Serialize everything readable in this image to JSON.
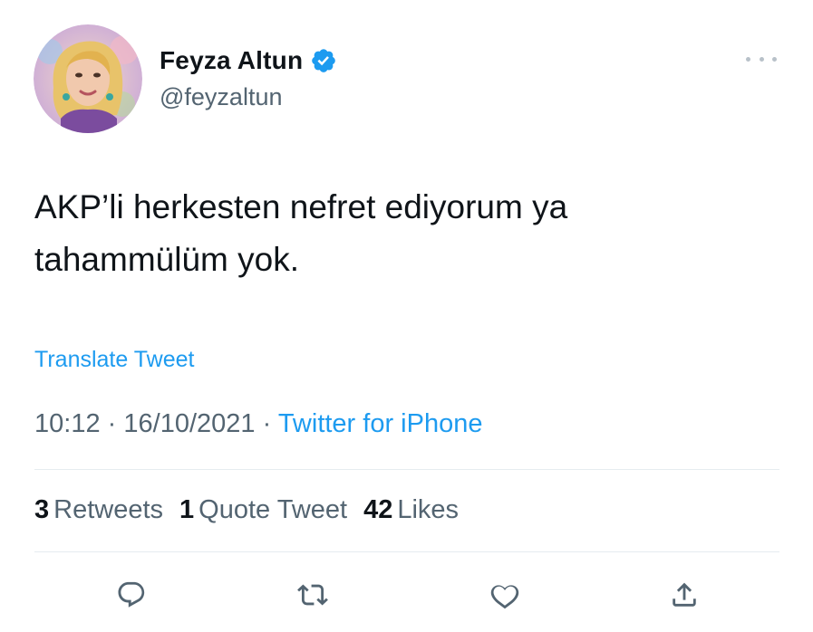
{
  "tweet": {
    "author": {
      "display_name": "Feyza Altun",
      "handle": "@feyzaltun",
      "verified": true,
      "avatar_icon": "profile-photo"
    },
    "text_line1": "AKP’li herkesten nefret ediyorum ya",
    "text_line2": "tahammülüm yok.",
    "translate_label": "Translate Tweet",
    "time": "10:12",
    "separator": "·",
    "date": "16/10/2021",
    "source": "Twitter for iPhone",
    "stats": {
      "retweets_count": "3",
      "retweets_label": "Retweets",
      "quotes_count": "1",
      "quotes_label": "Quote Tweet",
      "likes_count": "42",
      "likes_label": "Likes"
    },
    "actions": [
      "reply-icon",
      "retweet-icon",
      "like-icon",
      "share-icon"
    ]
  },
  "colors": {
    "accent": "#1d9bf0",
    "text_primary": "#0f1419",
    "text_secondary": "#536471",
    "divider": "#e6ecf0",
    "icon": "#536471"
  }
}
